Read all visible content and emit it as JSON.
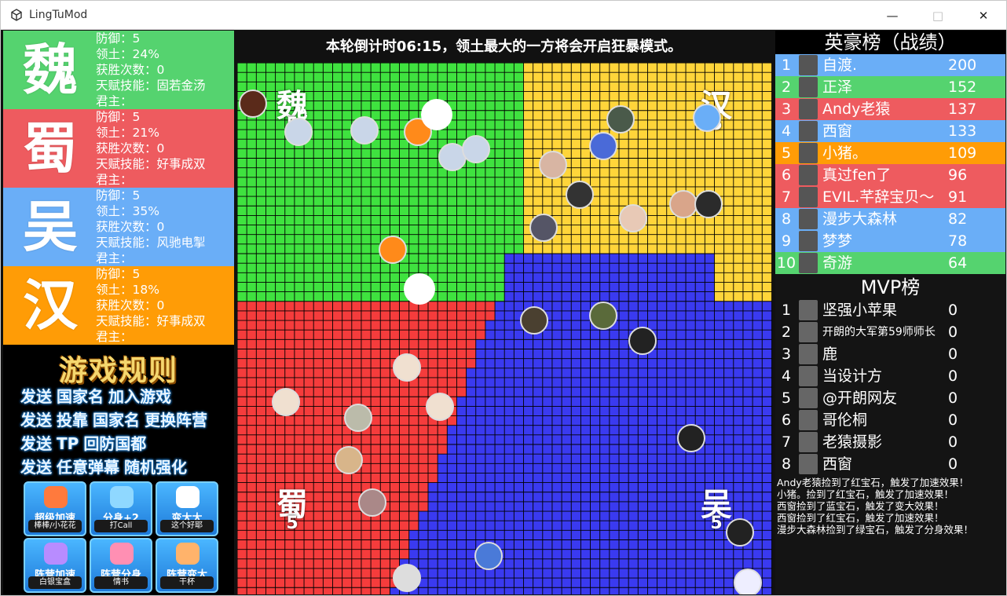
{
  "window": {
    "title": "LingTuMod",
    "icon": "unity-logo-icon"
  },
  "kingdoms": [
    {
      "name": "魏",
      "defense": "防御：5",
      "territory": "领土：24%",
      "wins": "获胜次数：0",
      "talent": "天赋技能：固若金汤",
      "lord": "君主：",
      "color": "#55d36f"
    },
    {
      "name": "蜀",
      "defense": "防御：5",
      "territory": "领土：21%",
      "wins": "获胜次数：0",
      "talent": "天赋技能：好事成双",
      "lord": "君主：",
      "color": "#ee5b5f"
    },
    {
      "name": "吴",
      "defense": "防御：5",
      "territory": "领土：35%",
      "wins": "获胜次数：0",
      "talent": "天赋技能：风驰电掣",
      "lord": "君主：",
      "color": "#6aaef7"
    },
    {
      "name": "汉",
      "defense": "防御：5",
      "territory": "领土：18%",
      "wins": "获胜次数：0",
      "talent": "天赋技能：好事成双",
      "lord": "君主：",
      "color": "#ff9c06"
    }
  ],
  "rules": {
    "title": "游戏规则",
    "lines": [
      [
        "发送",
        "国家名",
        "加入游戏"
      ],
      [
        "发送",
        "投靠",
        "国家名",
        "更换阵营"
      ],
      [
        "发送",
        "TP",
        "回防国都"
      ],
      [
        "发送",
        "任意弹幕",
        "随机强化"
      ]
    ],
    "gifts": [
      {
        "name": "超级加速",
        "sub": "棒棒/小花花",
        "icon": "glove-icon",
        "color": "#ff7a3d"
      },
      {
        "name": "分身+2",
        "sub": "打Call",
        "icon": "glowstick-icon",
        "color": "#8fd8ff"
      },
      {
        "name": "变大大",
        "sub": "这个好耶",
        "icon": "thumb-icon",
        "color": "#ffffff"
      },
      {
        "name": "阵营加速",
        "sub": "白银宝盒",
        "icon": "box-icon",
        "color": "#b88cff"
      },
      {
        "name": "阵营分身",
        "sub": "情书",
        "icon": "letter-icon",
        "color": "#ff8fb3"
      },
      {
        "name": "阵营变大",
        "sub": "干杯",
        "icon": "cheers-icon",
        "color": "#ffb36b"
      }
    ]
  },
  "map": {
    "banner": "本轮倒计时06:15，领土最大的一方将会开启狂暴模式。",
    "capitals": [
      {
        "name": "魏",
        "level": "5",
        "color": "#3fe23f"
      },
      {
        "name": "汉",
        "level": "5",
        "color": "#ffd53a"
      },
      {
        "name": "蜀",
        "level": "5",
        "color": "#f53c3c"
      },
      {
        "name": "吴",
        "level": "5",
        "color": "#3a3af0"
      }
    ]
  },
  "leaderboard": {
    "title": "英豪榜（战绩）",
    "rows": [
      {
        "rank": "1",
        "name": "自渡.",
        "score": "200",
        "color": "#6aaef7"
      },
      {
        "rank": "2",
        "name": "正泽",
        "score": "152",
        "color": "#55d36f"
      },
      {
        "rank": "3",
        "name": "Andy老猿",
        "score": "137",
        "color": "#ee5b5f"
      },
      {
        "rank": "4",
        "name": "西窗",
        "score": "133",
        "color": "#6aaef7"
      },
      {
        "rank": "5",
        "name": "小猪。",
        "score": "109",
        "color": "#ff9c06"
      },
      {
        "rank": "6",
        "name": "真过fen了",
        "score": "96",
        "color": "#ee5b5f"
      },
      {
        "rank": "7",
        "name": "EVIL.芊辞宝贝～",
        "score": "91",
        "color": "#ee5b5f"
      },
      {
        "rank": "8",
        "name": "漫步大森林",
        "score": "82",
        "color": "#6aaef7"
      },
      {
        "rank": "9",
        "name": "梦梦",
        "score": "78",
        "color": "#6aaef7"
      },
      {
        "rank": "10",
        "name": "奇游",
        "score": "64",
        "color": "#55d36f"
      }
    ]
  },
  "mvp": {
    "title": "MVP榜",
    "rows": [
      {
        "rank": "1",
        "name": "坚强小苹果",
        "score": "0"
      },
      {
        "rank": "2",
        "name": "开朗的大军第59师师长",
        "score": "0"
      },
      {
        "rank": "3",
        "name": "鹿",
        "score": "0"
      },
      {
        "rank": "4",
        "name": "当设计方",
        "score": "0"
      },
      {
        "rank": "5",
        "name": "@开朗网友",
        "score": "0"
      },
      {
        "rank": "6",
        "name": "哥伦桐",
        "score": "0"
      },
      {
        "rank": "7",
        "name": "老猿摄影",
        "score": "0"
      },
      {
        "rank": "8",
        "name": "西窗",
        "score": "0"
      }
    ]
  },
  "log": [
    "Andy老猿捡到了红宝石，触发了加速效果！",
    "小猪。捡到了红宝石，触发了加速效果！",
    "西窗捡到了蓝宝石，触发了变大效果！",
    "西窗捡到了红宝石，触发了加速效果！",
    "漫步大森林捡到了绿宝石，触发了分身效果！"
  ]
}
